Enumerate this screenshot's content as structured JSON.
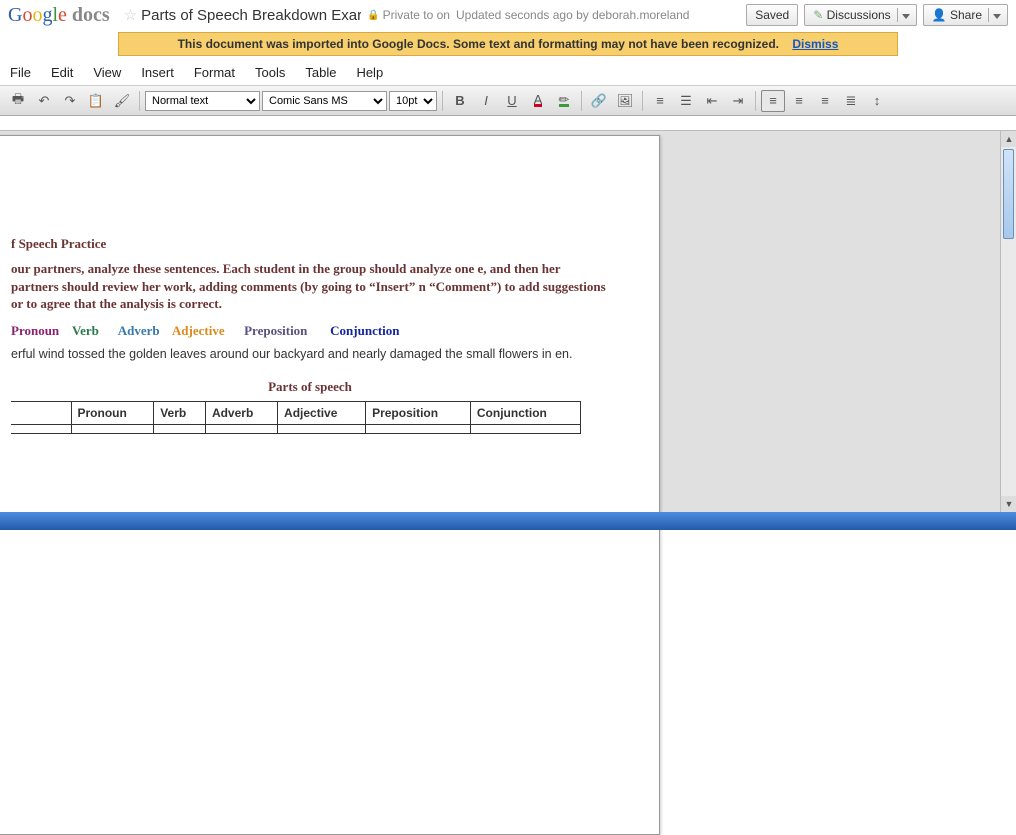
{
  "logo": {
    "brand": "Google",
    "product": "docs"
  },
  "doc": {
    "title": "Parts of Speech Breakdown Exar",
    "privacy": "Private to on",
    "update": "Updated seconds ago by deborah.moreland"
  },
  "buttons": {
    "saved": "Saved",
    "discussions": "Discussions",
    "share": "Share"
  },
  "banner": {
    "text": "This document was imported into Google Docs. Some text and formatting may not have been recognized.",
    "dismiss": "Dismiss"
  },
  "menu": {
    "file": "File",
    "edit": "Edit",
    "view": "View",
    "insert": "Insert",
    "format": "Format",
    "tools": "Tools",
    "table": "Table",
    "help": "Help"
  },
  "toolbar": {
    "style": "Normal text",
    "font": "Comic Sans MS",
    "size": "10pt"
  },
  "content": {
    "heading": "f Speech Practice",
    "instructions": "our partners, analyze these sentences. Each student in the group should analyze one e, and then her partners should review her work, adding comments (by going to “Insert” n “Comment”) to add suggestions or to agree that the analysis is correct.",
    "pos": {
      "pronoun": "Pronoun",
      "verb": "Verb",
      "adverb": "Adverb",
      "adjective": "Adjective",
      "preposition": "Preposition",
      "conjunction": "Conjunction"
    },
    "sentence": "erful wind tossed the golden leaves around our backyard and nearly damaged the small flowers in en.",
    "tableTitle": "Parts of speech",
    "table": [
      "Pronoun",
      "Verb",
      "Adverb",
      "Adjective",
      "Preposition",
      "Conjunction"
    ]
  }
}
